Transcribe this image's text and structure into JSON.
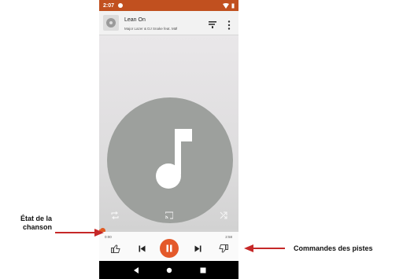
{
  "status_bar": {
    "time": "2:07"
  },
  "now_playing": {
    "title": "Lean On",
    "artist": "Major Lazer & DJ Snake feat. MØ"
  },
  "playback": {
    "current_time": "0:00",
    "total_time": "2:58",
    "progress": 0.01,
    "state": "playing"
  },
  "annotations": {
    "song_state": "État de la chanson",
    "track_controls": "Commandes des pistes"
  },
  "colors": {
    "status_bar": "#c1501f",
    "accent": "#e4592a",
    "annotation_arrow": "#c62828",
    "album_art": "#9da09d"
  }
}
